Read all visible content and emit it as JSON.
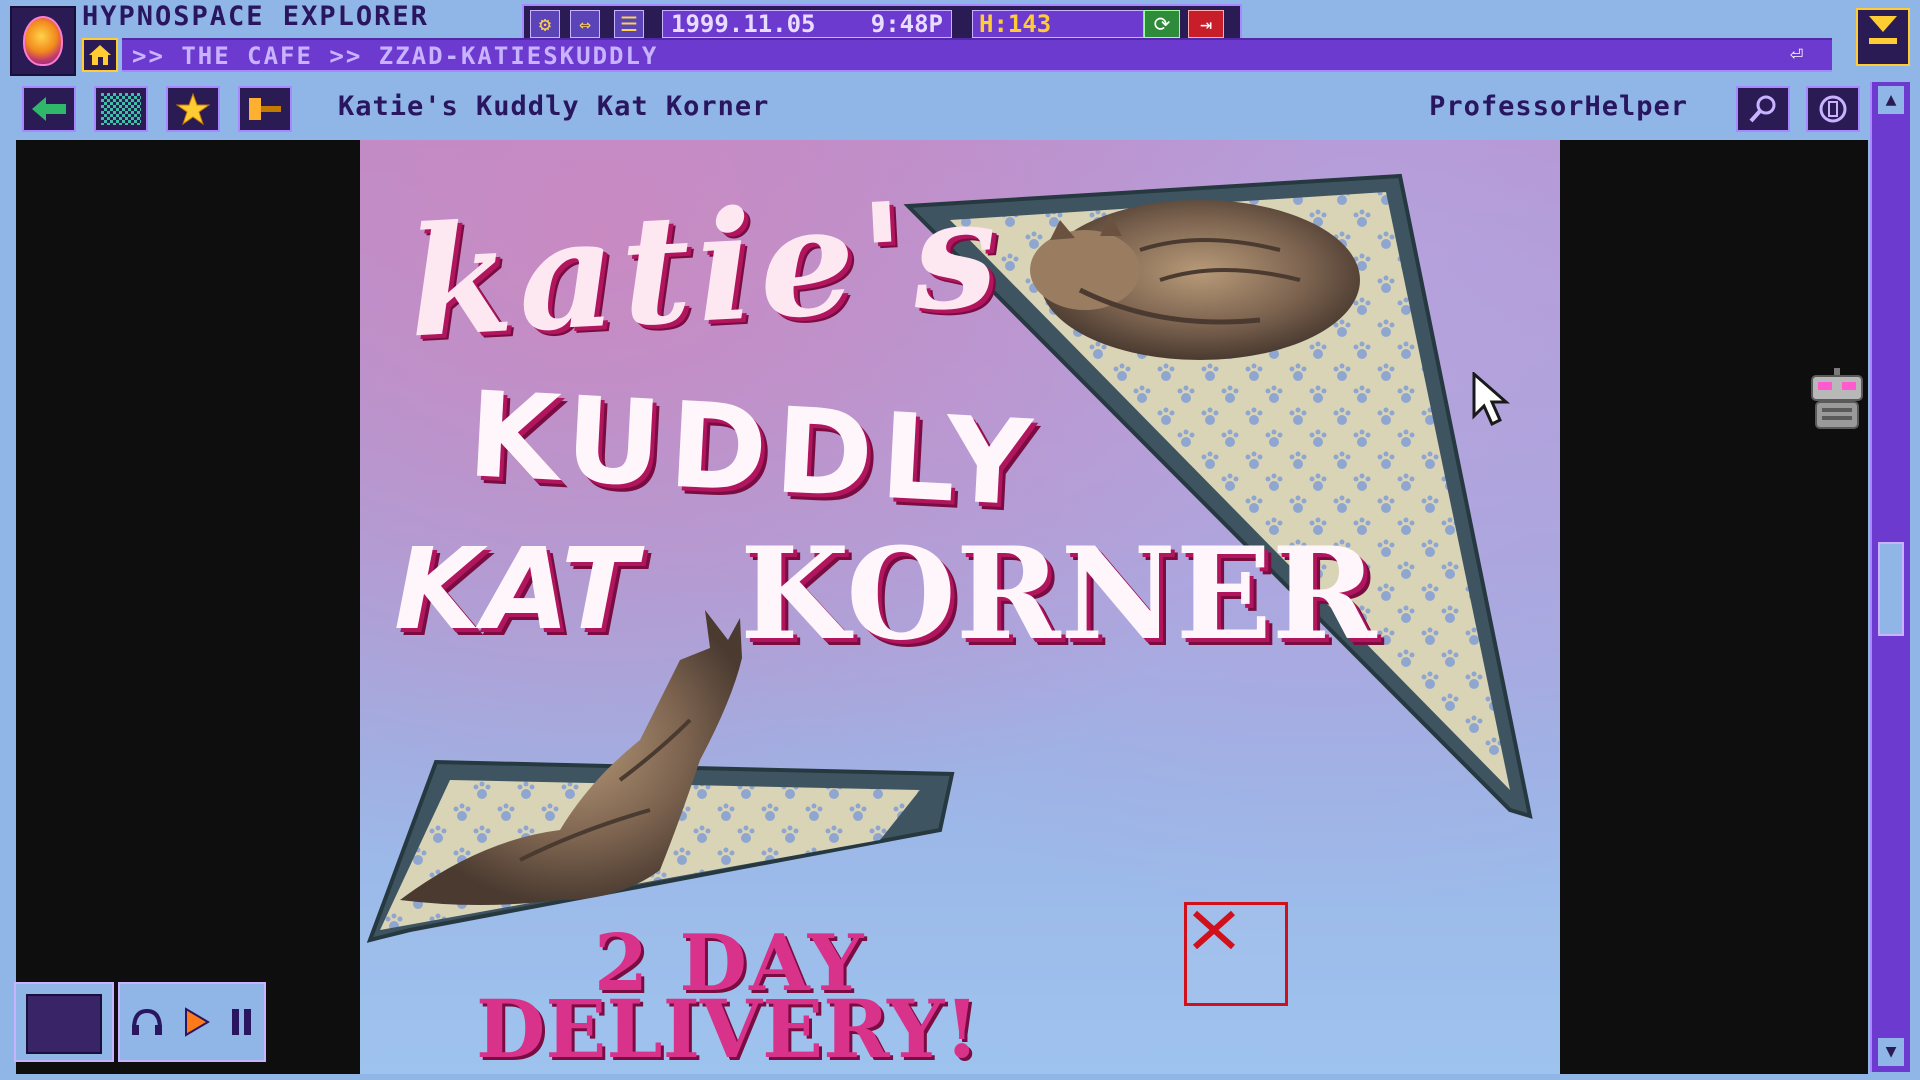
{
  "app": {
    "title": "HYPNOSPACE EXPLORER",
    "address": ">> THE CAFE >> ZZAD-KATIESKUDDLY",
    "date": "1999.11.05",
    "time": "9:48P",
    "counter": "H:143"
  },
  "nav": {
    "page_title": "Katie's Kuddly Kat Korner",
    "user": "ProfessorHelper"
  },
  "page": {
    "headline_line1": "katie's",
    "headline_line2": "KUDDLY",
    "headline_line3a": "KAT",
    "headline_line3b": "KORNER",
    "promo_line1": "2 DAY",
    "promo_line2": "DELIVERY!"
  },
  "colors": {
    "chrome": "#8fb6e6",
    "chrome_dark": "#2b1b55",
    "address_bg": "#6d3ad0",
    "headline_shadow": "#b0155e",
    "promo_text": "#d8328a"
  },
  "icons": {
    "back": "arrow-left-icon",
    "texture": "checker-icon",
    "favorite": "star-icon",
    "gavel": "gavel-icon",
    "search": "magnifier-icon",
    "coin": "hypnocoin-icon"
  }
}
